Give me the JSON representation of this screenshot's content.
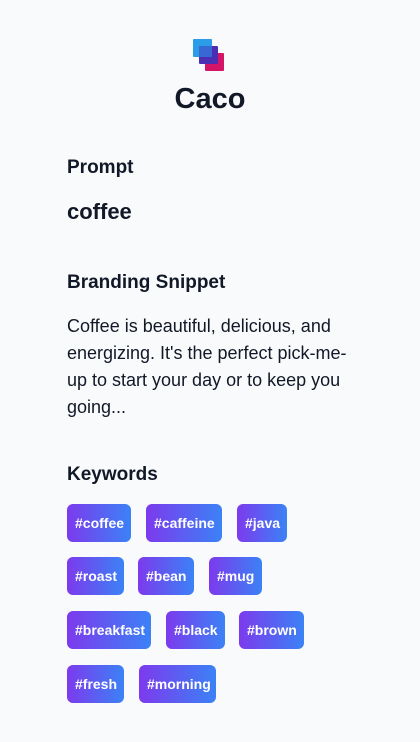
{
  "app": {
    "name": "Caco",
    "logo_icon": "stacked-squares-logo-icon",
    "colors": {
      "background": "#f9fafb",
      "text": "#111827",
      "chip_gradient_start": "#7c3aed",
      "chip_gradient_end": "#3b82f6"
    }
  },
  "prompt": {
    "label": "Prompt",
    "value": "coffee"
  },
  "snippet": {
    "label": "Branding Snippet",
    "text": "Coffee is beautiful, delicious, and energizing. It's the perfect pick-me-up to start your day or to keep you going..."
  },
  "keywords": {
    "label": "Keywords",
    "items": [
      "#coffee",
      "#caffeine",
      "#java",
      "#roast",
      "#bean",
      "#mug",
      "#breakfast",
      "#black",
      "#brown",
      "#fresh",
      "#morning"
    ]
  }
}
